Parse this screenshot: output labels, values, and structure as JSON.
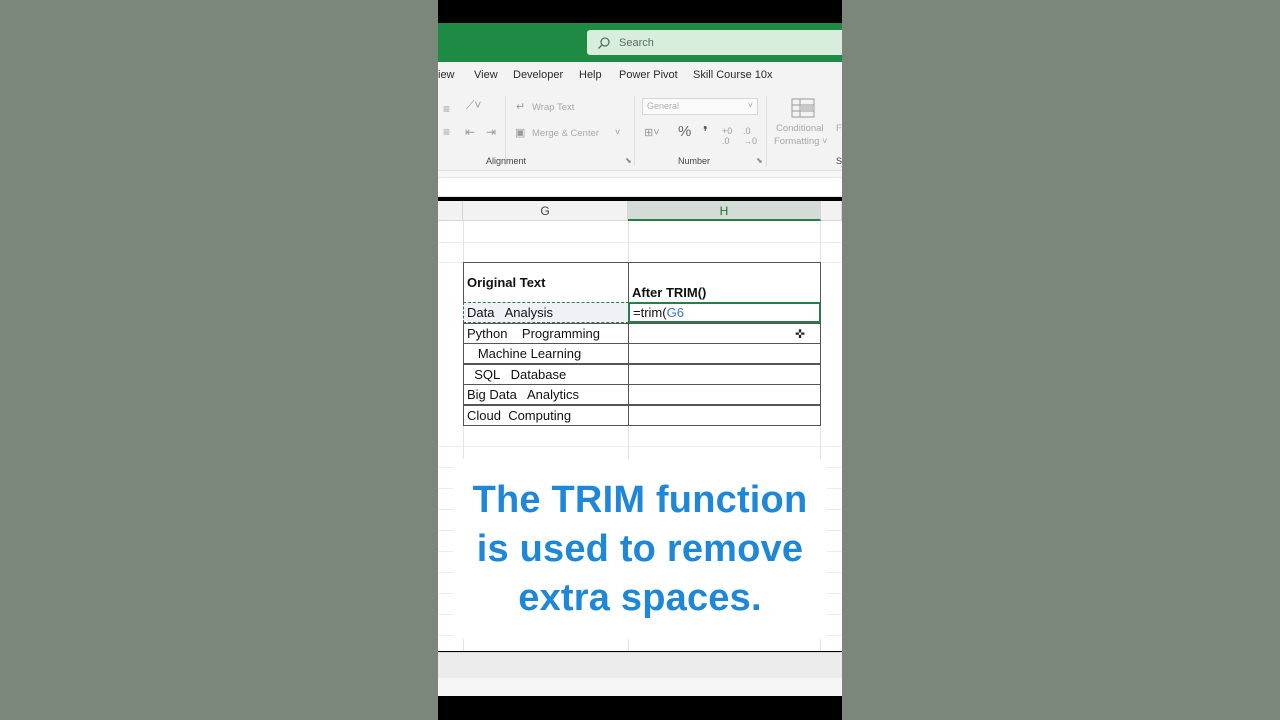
{
  "search": {
    "label": "Search"
  },
  "menu": {
    "items": [
      "iew",
      "View",
      "Developer",
      "Help",
      "Power Pivot",
      "Skill Course 10x"
    ]
  },
  "ribbon": {
    "wrap_text": "Wrap Text",
    "merge_center": "Merge & Center",
    "alignment_label": "Alignment",
    "number_format": "General",
    "percent": "%",
    "comma": "❜",
    "number_label": "Number",
    "conditional": "Conditional",
    "formatting": "Formatting ˅",
    "truncated_f": "F",
    "truncated_st": "St"
  },
  "columns": {
    "g": "G",
    "h": "H"
  },
  "table": {
    "header_original": "Original Text",
    "header_after": "After TRIM()",
    "rows": [
      "Data   Analysis",
      "Python    Programming",
      "   Machine Learning",
      "  SQL   Database",
      "Big Data   Analytics",
      "Cloud  Computing"
    ],
    "formula_prefix": "=trim(",
    "formula_ref": "G6"
  },
  "caption": {
    "line1": "The TRIM function",
    "line2": "is used to remove",
    "line3": "extra spaces."
  },
  "colors": {
    "excel_green": "#1f8a43",
    "caption_blue": "#1f87d8"
  }
}
